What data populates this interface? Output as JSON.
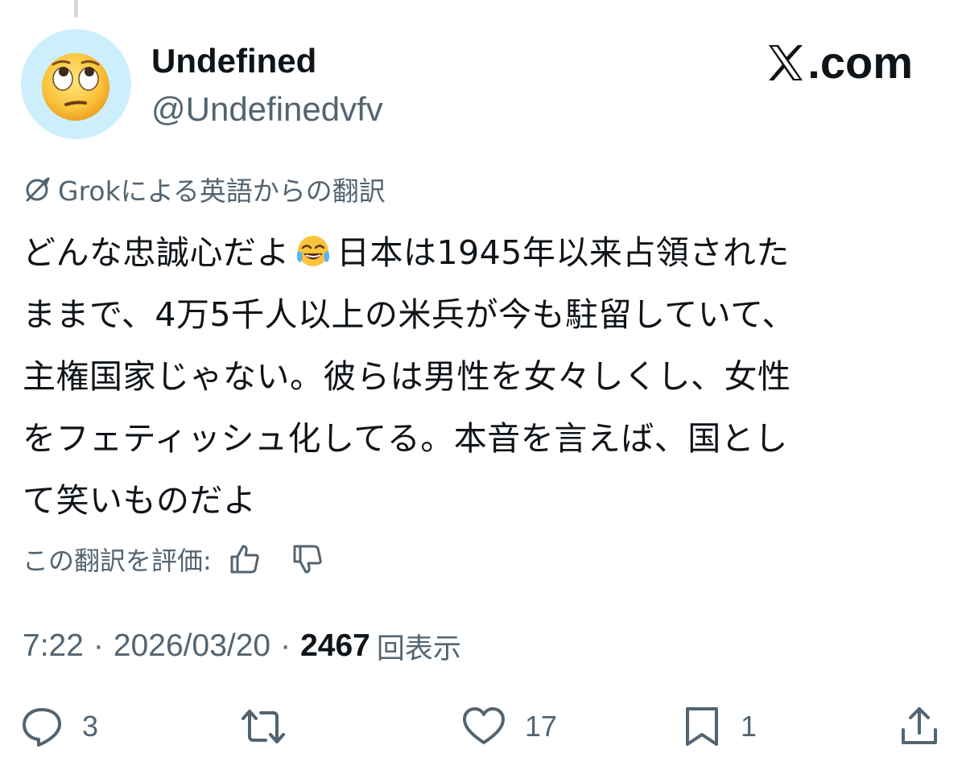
{
  "tweet": {
    "author": {
      "display_name": "Undefined",
      "handle": "@Undefinedvfv",
      "avatar_icon": "face-with-rolling-eyes-emoji",
      "avatar_bg": "#cdeffc"
    },
    "brand": {
      "logo_icon": "x-logo-icon",
      "text": ".com"
    },
    "translation_note": {
      "icon": "grok-icon",
      "label": "Grokによる英語からの翻訳"
    },
    "text_lines": [
      {
        "before": "どんな忠誠心だよ",
        "emoji": "face-with-tears-of-joy-emoji",
        "after": "日本は1945年以来占領された"
      },
      "ままで、4万5千人以上の米兵が今も駐留していて、",
      "主権国家じゃない。彼らは男性を女々しくし、女性",
      "をフェティッシュ化してる。本音を言えば、国とし",
      "て笑いものだよ"
    ],
    "rate_translation": {
      "label": "この翻訳を評価:",
      "thumbs_up_icon": "thumbs-up-icon",
      "thumbs_down_icon": "thumbs-down-icon"
    },
    "meta": {
      "time": "7:22",
      "separator": "·",
      "date": "2026/03/20",
      "views_count": "2467",
      "views_label": "回表示"
    },
    "actions": {
      "reply": {
        "icon": "reply-icon",
        "count": "3"
      },
      "retweet": {
        "icon": "retweet-icon"
      },
      "like": {
        "icon": "heart-icon",
        "count": "17"
      },
      "bookmark": {
        "icon": "bookmark-icon",
        "count": "1"
      },
      "share": {
        "icon": "share-icon"
      }
    }
  },
  "colors": {
    "text_primary": "#0f1419",
    "text_secondary": "#536471",
    "thread_line": "#cfd9de",
    "background": "#ffffff"
  }
}
